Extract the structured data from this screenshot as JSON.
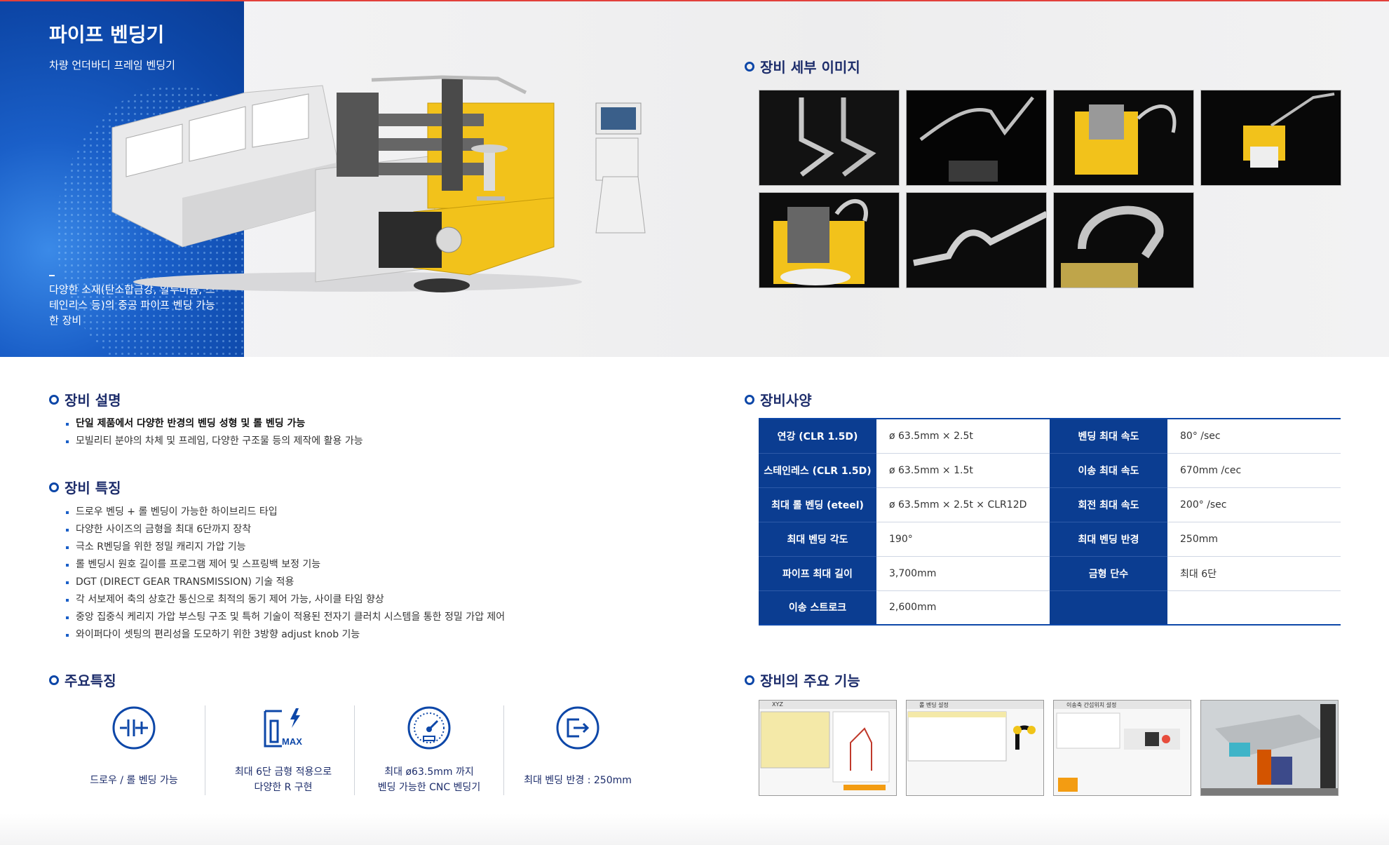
{
  "hero": {
    "title": "파이프 벤딩기",
    "subtitle": "차량 언더바디 프레임 벤딩기",
    "description": "다양한 소재(탄소합금강, 알루미늄, 스테인리스 등)의 중공 파이프 벤딩 가능한 장비"
  },
  "detail_images": {
    "title": "장비 세부 이미지",
    "images": [
      "pipe-bend-sample-1",
      "pipe-bend-sample-2",
      "bending-head-closeup",
      "bending-head-with-pipe",
      "bending-die-closeup",
      "bent-pipe-sample",
      "u-bend-sample"
    ]
  },
  "description_section": {
    "title": "장비 설명",
    "items": [
      "단일 제품에서 다양한 반경의 벤딩 성형 및 롤 벤딩 가능",
      "모빌리티 분야의 차체 및 프레임, 다양한 구조물 등의 제작에 활용 가능"
    ]
  },
  "features_section": {
    "title": "장비 특징",
    "items": [
      "드로우 벤딩 + 롤 벤딩이 가능한 하이브리드 타입",
      "다양한 사이즈의 금형을 최대 6단까지 장착",
      "극소 R벤딩을 위한 정밀 캐리지 가압 기능",
      "롤 벤딩시 원호 길이를 프로그램 제어 및 스프링백 보정 기능",
      "DGT (DIRECT GEAR TRANSMISSION) 기술 적용",
      "각 서보제어 축의 상호간 통신으로 최적의 동기 제어 가능, 사이클 타임 향상",
      "중앙 집중식 케리지 가압 부스팅 구조 및 특허 기술이 적용된 전자기 클러치 시스템을 통한 정밀 가압 제어",
      "와이퍼다이 셋팅의 편리성을 도모하기 위한 3방향 adjust knob 기능"
    ]
  },
  "spec_section": {
    "title": "장비사양",
    "rows": [
      [
        {
          "label": "연강 (CLR 1.5D)",
          "value": "ø 63.5mm × 2.5t"
        },
        {
          "label": "벤딩 최대 속도",
          "value": "80° /sec"
        }
      ],
      [
        {
          "label": "스테인레스 (CLR 1.5D)",
          "value": "ø 63.5mm × 1.5t"
        },
        {
          "label": "이송 최대 속도",
          "value": "670mm /cec"
        }
      ],
      [
        {
          "label": "최대 롤 벤딩 (eteel)",
          "value": "ø 63.5mm × 2.5t × CLR12D"
        },
        {
          "label": "회전 최대 속도",
          "value": "200° /sec"
        }
      ],
      [
        {
          "label": "최대 벤딩 각도",
          "value": "190°"
        },
        {
          "label": "최대 벤딩 반경",
          "value": "250mm"
        }
      ],
      [
        {
          "label": "파이프 최대 길이",
          "value": "3,700mm"
        },
        {
          "label": "금형 단수",
          "value": "최대 6단"
        }
      ],
      [
        {
          "label": "이송 스트로크",
          "value": "2,600mm"
        },
        {
          "label": "",
          "value": ""
        }
      ]
    ]
  },
  "key_features": {
    "title": "주요특징",
    "items": [
      {
        "icon": "draw-roll-bending-icon",
        "line1": "드로우 / 롤 벤딩 가능",
        "line2": ""
      },
      {
        "icon": "max-die-icon",
        "line1": "최대 6단 금형 적용으로",
        "line2": "다양한 R 구현"
      },
      {
        "icon": "gauge-icon",
        "line1": "최대 ø63.5mm 까지",
        "line2": "벤딩 가능한 CNC 벤딩기"
      },
      {
        "icon": "bending-radius-icon",
        "line1": "최대 벤딩 반경 : 250mm",
        "line2": ""
      }
    ],
    "max_label": "MAX"
  },
  "functions": {
    "title": "장비의 주요 기능",
    "screens": [
      {
        "caption": "XYZ"
      },
      {
        "caption": "롤 벤딩 설정"
      },
      {
        "caption": "이송축 간섭위치 설정"
      },
      {
        "caption": ""
      }
    ]
  },
  "colors": {
    "primary": "#0d47a8",
    "header_cell": "#0b3d91",
    "heading": "#1d2d6b",
    "accent_yellow": "#f2c21b"
  }
}
